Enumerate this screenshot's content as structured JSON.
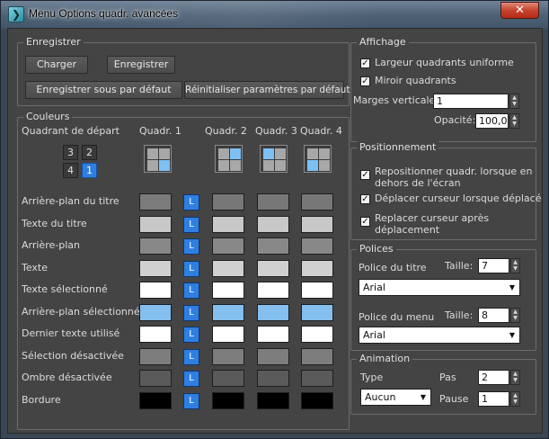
{
  "window": {
    "title": "Menu Options quadr. avancées",
    "close_glyph": "✕",
    "app_icon_glyph": "❯"
  },
  "enregistrer": {
    "title": "Enregistrer",
    "load_label": "Charger",
    "save_label": "Enregistrer",
    "save_default_label": "Enregistrer sous par défaut",
    "reset_label": "Réinitialiser paramètres par défaut"
  },
  "couleurs": {
    "title": "Couleurs",
    "start_quadrant_label": "Quadrant de départ",
    "quadrant_headers": [
      "Quadr. 1",
      "Quadr. 2",
      "Quadr. 3",
      "Quadr. 4"
    ],
    "quadrant_buttons": [
      "3",
      "2",
      "4",
      "1"
    ],
    "active_quadrant": "1",
    "lock_label": "L",
    "rows": [
      {
        "label": "Arrière-plan du titre",
        "colors": [
          "#7b7b7b",
          "#777777",
          "#777777",
          "#777777"
        ]
      },
      {
        "label": "Texte du titre",
        "colors": [
          "#c8c8c8",
          "#c8c8c8",
          "#c8c8c8",
          "#c8c8c8"
        ]
      },
      {
        "label": "Arrière-plan",
        "colors": [
          "#888888",
          "#888888",
          "#888888",
          "#888888"
        ]
      },
      {
        "label": "Texte",
        "colors": [
          "#d0d0d0",
          "#d0d0d0",
          "#d0d0d0",
          "#d0d0d0"
        ]
      },
      {
        "label": "Texte sélectionné",
        "colors": [
          "#ffffff",
          "#ffffff",
          "#ffffff",
          "#ffffff"
        ]
      },
      {
        "label": "Arrière-plan sélectionné",
        "colors": [
          "#84bff0",
          "#84bff0",
          "#84bff0",
          "#84bff0"
        ]
      },
      {
        "label": "Dernier texte utilisé",
        "colors": [
          "#ffffff",
          "#ffffff",
          "#ffffff",
          "#ffffff"
        ]
      },
      {
        "label": "Sélection désactivée",
        "colors": [
          "#7d7d7d",
          "#7d7d7d",
          "#7d7d7d",
          "#7d7d7d"
        ]
      },
      {
        "label": "Ombre désactivée",
        "colors": [
          "#5a5a5a",
          "#5a5a5a",
          "#5a5a5a",
          "#5a5a5a"
        ]
      },
      {
        "label": "Bordure",
        "colors": [
          "#000000",
          "#000000",
          "#000000",
          "#000000"
        ]
      }
    ]
  },
  "affichage": {
    "title": "Affichage",
    "uniform_width_label": "Largeur quadrants uniforme",
    "uniform_width_checked": true,
    "mirror_label": "Miroir quadrants",
    "mirror_checked": true,
    "margins_label": "Marges verticales",
    "margins_value": "1",
    "opacity_label": "Opacité:",
    "opacity_value": "100,0"
  },
  "positionnement": {
    "title": "Positionnement",
    "reposition_label_1": "Repositionner quadr. lorsque en",
    "reposition_label_2": "dehors de l'écran",
    "move_cursor_label": "Déplacer curseur lorsque déplacé",
    "replace_cursor_label_1": "Replacer curseur après",
    "replace_cursor_label_2": "déplacement",
    "check_glyph": "✓"
  },
  "polices": {
    "title": "Polices",
    "title_font_label": "Police du titre",
    "title_size_label": "Taille:",
    "title_size_value": "7",
    "title_font_value": "Arial",
    "menu_font_label": "Police du menu",
    "menu_size_label": "Taille:",
    "menu_size_value": "8",
    "menu_font_value": "Arial"
  },
  "animation": {
    "title": "Animation",
    "type_label": "Type",
    "type_value": "Aucun",
    "step_label": "Pas",
    "step_value": "2",
    "pause_label": "Pause",
    "pause_value": "1"
  },
  "glyphs": {
    "up": "▲",
    "down": "▼"
  }
}
